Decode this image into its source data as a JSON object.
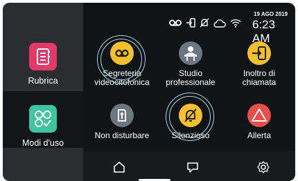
{
  "status": {
    "date": "19 AGO 2019",
    "time": "6:23 AM",
    "icons": [
      "voicemail-icon",
      "forward-icon",
      "mute-icon",
      "cloud-icon",
      "wifi-icon"
    ]
  },
  "sidebar": {
    "items": [
      {
        "label": "Rubrica",
        "color": "#e33a6a"
      },
      {
        "label": "Modi d'uso",
        "color": "#3ec4a0"
      }
    ]
  },
  "apps": [
    {
      "label_line1": "Segreteria",
      "label_line2": "videocitofonica",
      "color": "#f6c02d",
      "icon": "voicemail-icon"
    },
    {
      "label_line1": "Studio",
      "label_line2": "professionale",
      "color": "#6b7780",
      "icon": "desk-person-icon"
    },
    {
      "label_line1": "Inoltro di",
      "label_line2": "chiamata",
      "color": "#f6c02d",
      "icon": "call-forward-icon"
    },
    {
      "label_line1": "Non disturbare",
      "label_line2": "",
      "color": "#6b7780",
      "icon": "do-not-disturb-icon"
    },
    {
      "label_line1": "Silenzioso",
      "label_line2": "",
      "color": "#f6c02d",
      "icon": "bell-off-icon"
    },
    {
      "label_line1": "Allerta",
      "label_line2": "",
      "color": "#e84e4a",
      "icon": "alert-icon"
    }
  ],
  "navbar": {
    "icons": [
      "home-icon",
      "chat-icon",
      "settings-icon"
    ]
  },
  "pager": {
    "active_color": "#f6c02d",
    "inactive_color": "#8a8a8a"
  }
}
